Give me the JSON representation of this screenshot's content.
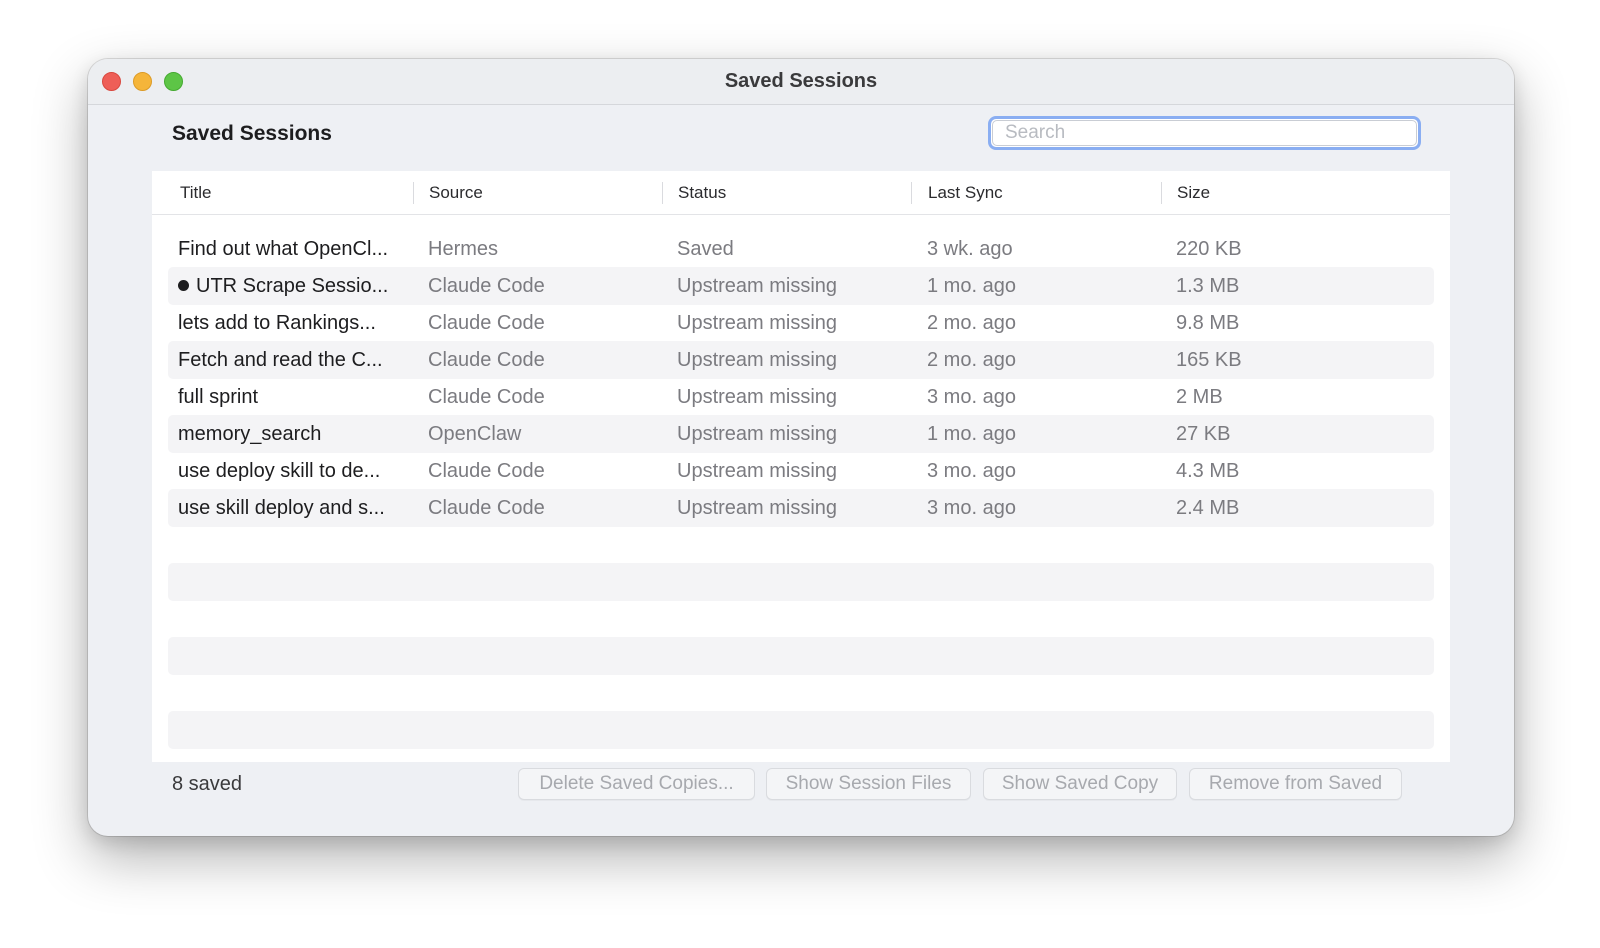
{
  "window": {
    "title": "Saved Sessions",
    "controls": [
      "close",
      "minimize",
      "zoom"
    ]
  },
  "header": {
    "title": "Saved Sessions",
    "search_placeholder": "Search",
    "search_value": ""
  },
  "table": {
    "columns": [
      "Title",
      "Source",
      "Status",
      "Last Sync",
      "Size"
    ],
    "rows": [
      {
        "title": "Find out what OpenCl...",
        "source": "Hermes",
        "status": "Saved",
        "last_sync": "3 wk. ago",
        "size": "220 KB",
        "active": false
      },
      {
        "title": "UTR Scrape Sessio...",
        "source": "Claude Code",
        "status": "Upstream missing",
        "last_sync": "1 mo. ago",
        "size": "1.3 MB",
        "active": true
      },
      {
        "title": "lets add to Rankings...",
        "source": "Claude Code",
        "status": "Upstream missing",
        "last_sync": "2 mo. ago",
        "size": "9.8 MB",
        "active": false
      },
      {
        "title": "Fetch and read the C...",
        "source": "Claude Code",
        "status": "Upstream missing",
        "last_sync": "2 mo. ago",
        "size": "165 KB",
        "active": false
      },
      {
        "title": "full sprint",
        "source": "Claude Code",
        "status": "Upstream missing",
        "last_sync": "3 mo. ago",
        "size": "2 MB",
        "active": false
      },
      {
        "title": "memory_search",
        "source": "OpenClaw",
        "status": "Upstream missing",
        "last_sync": "1 mo. ago",
        "size": "27 KB",
        "active": false
      },
      {
        "title": "use deploy skill to de...",
        "source": "Claude Code",
        "status": "Upstream missing",
        "last_sync": "3 mo. ago",
        "size": "4.3 MB",
        "active": false
      },
      {
        "title": "use skill deploy and s...",
        "source": "Claude Code",
        "status": "Upstream missing",
        "last_sync": "3 mo. ago",
        "size": "2.4 MB",
        "active": false
      }
    ]
  },
  "footer": {
    "count_label": "8 saved",
    "buttons": {
      "delete_saved_copies": "Delete Saved Copies...",
      "show_session_files": "Show Session Files",
      "show_saved_copy": "Show Saved Copy",
      "remove_from_saved": "Remove from Saved"
    }
  },
  "colors": {
    "window_bg": "#eef0f4",
    "row_alt": "#f4f4f6",
    "focus_ring": "#8aaef2",
    "close": "#ee5e57",
    "minimize": "#f5b53a",
    "zoom": "#5dc546",
    "disabled_text": "#a7a9ae"
  }
}
